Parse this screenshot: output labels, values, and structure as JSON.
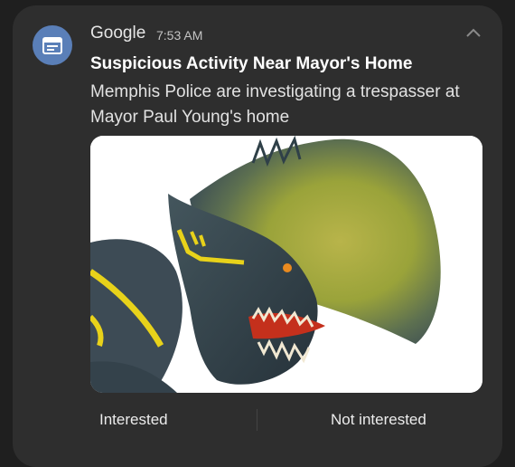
{
  "notification": {
    "app_name": "Google",
    "time": "7:53 AM",
    "app_icon": "calendar-news-icon",
    "collapse_icon": "chevron-up-icon",
    "title": "Suspicious Activity Near Mayor's Home",
    "body": "Memphis Police are investigating a trespasser at Mayor Paul Young's home",
    "image": "dinosaur-kaiju-toy-figure",
    "actions": [
      {
        "label": "Interested"
      },
      {
        "label": "Not interested"
      }
    ]
  },
  "colors": {
    "card_bg": "#2e2e2e",
    "icon_bg": "#5a7fb8",
    "title": "#ffffff",
    "body": "#e2e2e2"
  }
}
